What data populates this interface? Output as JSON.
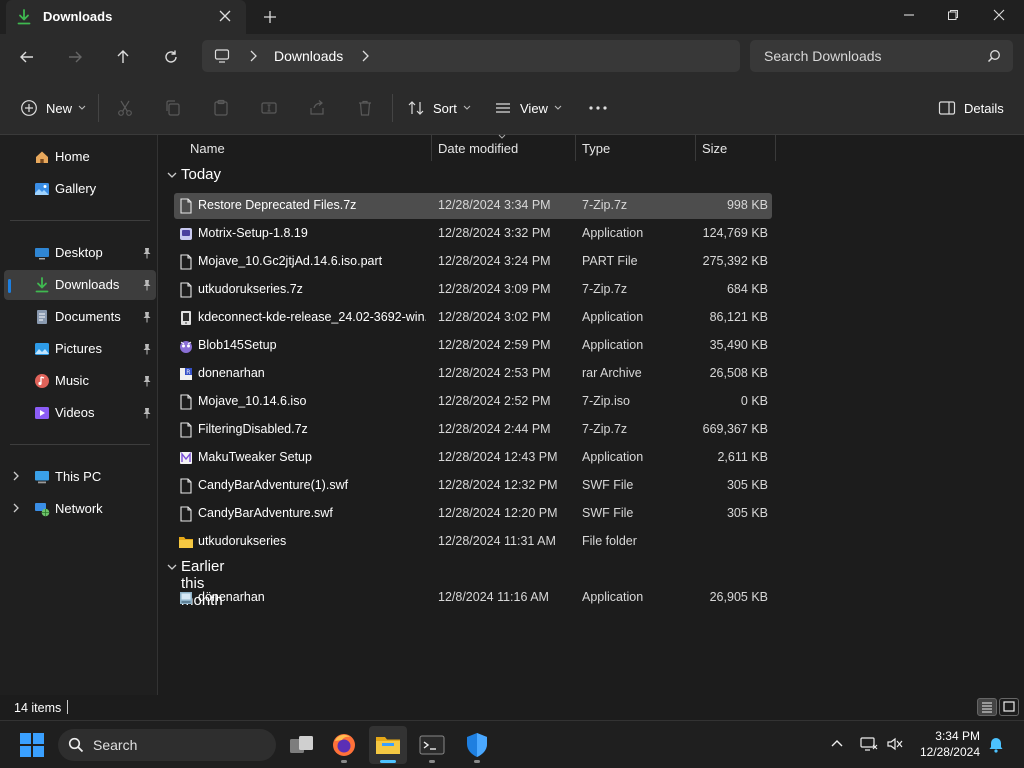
{
  "window": {
    "tab_title": "Downloads",
    "colors": {
      "accent": "#4cc2ff",
      "folder": "#f2c94c",
      "download_icon": "#3fb950"
    }
  },
  "address": {
    "crumbs": [
      "Downloads"
    ],
    "search_placeholder": "Search Downloads"
  },
  "toolbar": {
    "new_label": "New",
    "sort_label": "Sort",
    "view_label": "View",
    "details_label": "Details"
  },
  "sidebar": {
    "items": [
      {
        "label": "Home",
        "icon": "home-icon"
      },
      {
        "label": "Gallery",
        "icon": "gallery-icon"
      },
      {
        "label": "Desktop",
        "icon": "desktop-icon",
        "pinned": true
      },
      {
        "label": "Downloads",
        "icon": "download-icon",
        "pinned": true,
        "selected": true
      },
      {
        "label": "Documents",
        "icon": "documents-icon",
        "pinned": true
      },
      {
        "label": "Pictures",
        "icon": "pictures-icon",
        "pinned": true
      },
      {
        "label": "Music",
        "icon": "music-icon",
        "pinned": true
      },
      {
        "label": "Videos",
        "icon": "videos-icon",
        "pinned": true
      },
      {
        "label": "This PC",
        "icon": "this-pc-icon"
      },
      {
        "label": "Network",
        "icon": "network-icon"
      }
    ]
  },
  "columns": {
    "name": "Name",
    "date": "Date modified",
    "type": "Type",
    "size": "Size"
  },
  "groups": [
    {
      "label": "Today",
      "files": [
        {
          "name": "Restore Deprecated Files.7z",
          "date": "12/28/2024 3:34 PM",
          "type": "7-Zip.7z",
          "size": "998 KB",
          "icon": "file-icon",
          "selected": true
        },
        {
          "name": "Motrix-Setup-1.8.19",
          "date": "12/28/2024 3:32 PM",
          "type": "Application",
          "size": "124,769 KB",
          "icon": "installer-icon"
        },
        {
          "name": "Mojave_10.Gc2jtjAd.14.6.iso.part",
          "date": "12/28/2024 3:24 PM",
          "type": "PART File",
          "size": "275,392 KB",
          "icon": "file-icon"
        },
        {
          "name": "utkudorukseries.7z",
          "date": "12/28/2024 3:09 PM",
          "type": "7-Zip.7z",
          "size": "684 KB",
          "icon": "file-icon"
        },
        {
          "name": "kdeconnect-kde-release_24.02-3692-win...",
          "date": "12/28/2024 3:02 PM",
          "type": "Application",
          "size": "86,121 KB",
          "icon": "app-icon"
        },
        {
          "name": "Blob145Setup",
          "date": "12/28/2024 2:59 PM",
          "type": "Application",
          "size": "35,490 KB",
          "icon": "setup-icon"
        },
        {
          "name": "donenarhan",
          "date": "12/28/2024 2:53 PM",
          "type": "rar Archive",
          "size": "26,508 KB",
          "icon": "rar-icon"
        },
        {
          "name": "Mojave_10.14.6.iso",
          "date": "12/28/2024 2:52 PM",
          "type": "7-Zip.iso",
          "size": "0 KB",
          "icon": "file-icon"
        },
        {
          "name": "FilteringDisabled.7z",
          "date": "12/28/2024 2:44 PM",
          "type": "7-Zip.7z",
          "size": "669,367 KB",
          "icon": "file-icon"
        },
        {
          "name": "MakuTweaker Setup",
          "date": "12/28/2024 12:43 PM",
          "type": "Application",
          "size": "2,611 KB",
          "icon": "maku-icon"
        },
        {
          "name": "CandyBarAdventure(1).swf",
          "date": "12/28/2024 12:32 PM",
          "type": "SWF File",
          "size": "305 KB",
          "icon": "file-icon"
        },
        {
          "name": "CandyBarAdventure.swf",
          "date": "12/28/2024 12:20 PM",
          "type": "SWF File",
          "size": "305 KB",
          "icon": "file-icon"
        },
        {
          "name": "utkudorukseries",
          "date": "12/28/2024 11:31 AM",
          "type": "File folder",
          "size": "",
          "icon": "folder-icon"
        }
      ]
    },
    {
      "label": "Earlier this month",
      "files": [
        {
          "name": "dönenarhan",
          "date": "12/8/2024 11:16 AM",
          "type": "Application",
          "size": "26,905 KB",
          "icon": "exe-icon"
        }
      ]
    }
  ],
  "status": {
    "item_count": "14 items"
  },
  "taskbar": {
    "search_label": "Search",
    "time": "3:34 PM",
    "date": "12/28/2024"
  }
}
